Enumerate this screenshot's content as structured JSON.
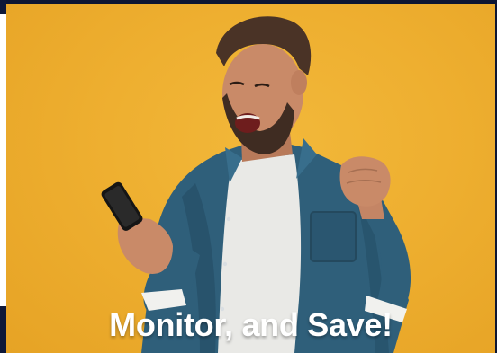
{
  "banner": {
    "caption": "Monitor, and Save!"
  },
  "colors": {
    "background": "#f0b232",
    "page_frame": "#0d1633",
    "shirt_denim": "#2f5f7a",
    "tshirt": "#e9e9e6",
    "skin": "#c98a68",
    "hair": "#4a3326",
    "caption_text": "#ffffff"
  },
  "image": {
    "subject": "excited-man-with-smartphone-photo"
  }
}
